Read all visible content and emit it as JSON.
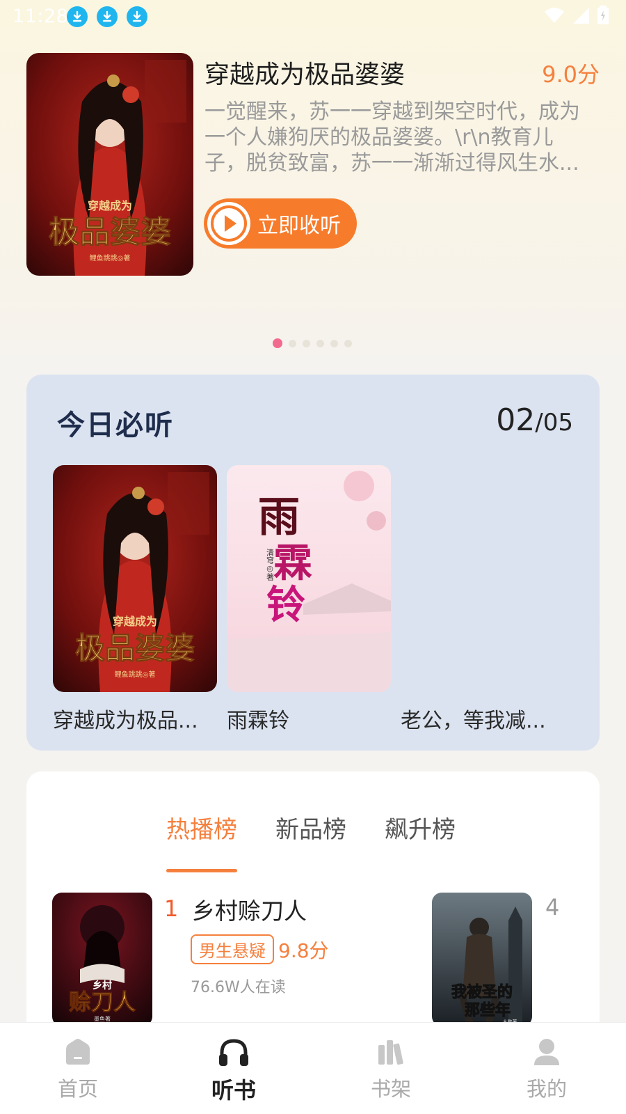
{
  "status_bar": {
    "time": "11:28"
  },
  "hero": {
    "title": "穿越成为极品婆婆",
    "score": "9.0分",
    "description": "一觉醒来，苏一一穿越到架空时代，成为一个人嫌狗厌的极品婆婆。\\r\\n教育儿子，脱贫致富，苏一一渐渐过得风生水...",
    "listen_label": "立即收听",
    "cover_title_small": "穿越成为",
    "cover_title_big": "极品婆婆",
    "cover_author": "鲤鱼跳跳◎著",
    "carousel_pages": 6,
    "carousel_active": 1
  },
  "today": {
    "title": "今日必听",
    "count_current": "02",
    "count_total": "/05",
    "items": [
      {
        "name": "穿越成为极品...",
        "cover_small": "穿越成为",
        "cover_big": "极品婆婆",
        "cover_author": "鲤鱼跳跳◎著"
      },
      {
        "name": "雨霖铃",
        "cover_big": "雨霖铃",
        "cover_author": "清穹◎著"
      },
      {
        "name": "老公，等我减..."
      }
    ]
  },
  "rank": {
    "tabs": [
      "热播榜",
      "新品榜",
      "飙升榜"
    ],
    "active_tab": 0,
    "items": [
      {
        "rank": "1",
        "title": "乡村赊刀人",
        "tag": "男生悬疑",
        "score": "9.8分",
        "readers": "76.6W人在读",
        "cover_small": "乡村",
        "cover_big": "赊刀人",
        "cover_author": "墨鱼著"
      },
      {
        "rank": "4",
        "cover_big": "我被圣的那些年",
        "cover_author": "大鹏著"
      }
    ]
  },
  "bottom_nav": [
    {
      "label": "首页",
      "icon": "home-icon"
    },
    {
      "label": "听书",
      "icon": "headphones-icon"
    },
    {
      "label": "书架",
      "icon": "bookshelf-icon"
    },
    {
      "label": "我的",
      "icon": "user-icon"
    }
  ],
  "colors": {
    "accent": "#f5803e",
    "card_blue": "#dbe3f0",
    "dot_active": "#f26a8d"
  }
}
